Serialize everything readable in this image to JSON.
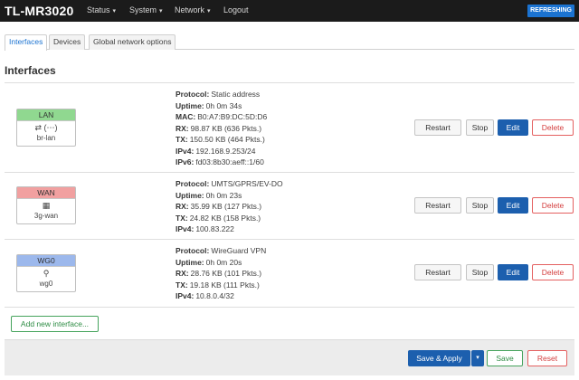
{
  "header": {
    "brand": "TL-MR3020",
    "menu": [
      {
        "label": "Status",
        "caret": "▾"
      },
      {
        "label": "System",
        "caret": "▾"
      },
      {
        "label": "Network",
        "caret": "▾"
      },
      {
        "label": "Logout",
        "caret": ""
      }
    ],
    "refresh_badge": "REFRESHING"
  },
  "tabs": [
    {
      "label": "Interfaces",
      "active": true
    },
    {
      "label": "Devices",
      "active": false
    },
    {
      "label": "Global network options",
      "active": false
    }
  ],
  "page_title": "Interfaces",
  "interfaces": [
    {
      "name": "LAN",
      "color": "#90d890",
      "icon": "bridge-icon",
      "icon_glyph": "⇄ (⋯)",
      "device": "br-lan",
      "info": [
        {
          "label": "Protocol:",
          "value": "Static address"
        },
        {
          "label": "Uptime:",
          "value": "0h 0m 34s"
        },
        {
          "label": "MAC:",
          "value": "B0:A7:B9:DC:5D:D6"
        },
        {
          "label": "RX:",
          "value": "98.87 KB (636 Pkts.)"
        },
        {
          "label": "TX:",
          "value": "150.50 KB (464 Pkts.)"
        },
        {
          "label": "IPv4:",
          "value": "192.168.9.253/24"
        },
        {
          "label": "IPv6:",
          "value": "fd03:8b30:aeff::1/60"
        }
      ]
    },
    {
      "name": "WAN",
      "color": "#f1a0a0",
      "icon": "modem-icon",
      "icon_glyph": "▦",
      "device": "3g-wan",
      "info": [
        {
          "label": "Protocol:",
          "value": "UMTS/GPRS/EV-DO"
        },
        {
          "label": "Uptime:",
          "value": "0h 0m 23s"
        },
        {
          "label": "RX:",
          "value": "35.99 KB (127 Pkts.)"
        },
        {
          "label": "TX:",
          "value": "24.82 KB (158 Pkts.)"
        },
        {
          "label": "IPv4:",
          "value": "100.83.222"
        }
      ]
    },
    {
      "name": "WG0",
      "color": "#9cb8ec",
      "icon": "tunnel-icon",
      "icon_glyph": "⚲",
      "device": "wg0",
      "info": [
        {
          "label": "Protocol:",
          "value": "WireGuard VPN"
        },
        {
          "label": "Uptime:",
          "value": "0h 0m 20s"
        },
        {
          "label": "RX:",
          "value": "28.76 KB (101 Pkts.)"
        },
        {
          "label": "TX:",
          "value": "19.18 KB (111 Pkts.)"
        },
        {
          "label": "IPv4:",
          "value": "10.8.0.4/32"
        }
      ]
    }
  ],
  "row_actions": {
    "restart": "Restart",
    "stop": "Stop",
    "edit": "Edit",
    "delete": "Delete"
  },
  "add_interface_label": "Add new interface...",
  "footer": {
    "save_apply": "Save & Apply",
    "dropdown_caret": "▾",
    "save": "Save",
    "reset": "Reset"
  }
}
